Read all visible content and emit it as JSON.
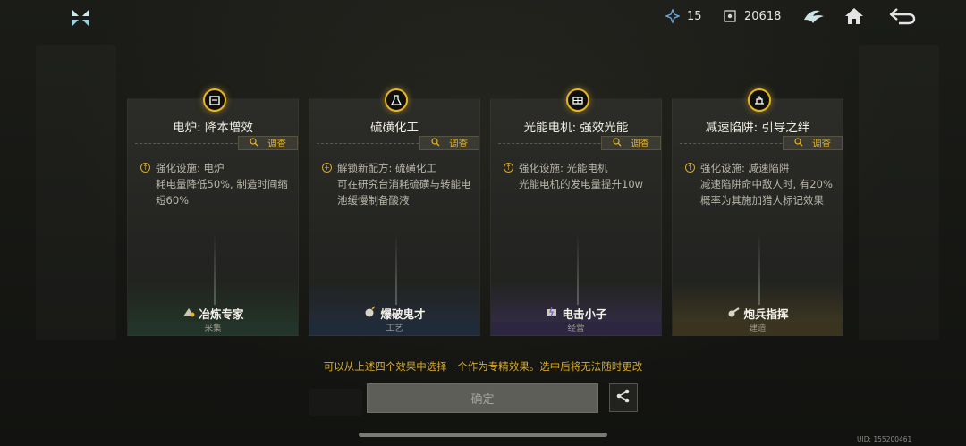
{
  "topbar": {
    "resource_a": "15",
    "resource_b": "20618",
    "icons": [
      "app-logo-icon",
      "crystal-icon",
      "target-icon",
      "emblem-icon",
      "home-icon",
      "back-arrow-icon"
    ]
  },
  "colors": {
    "accent_gold": "#e4b526",
    "hint_text": "#d7ab2e",
    "footer_green": "#23352a",
    "footer_blue": "#202b3a",
    "footer_purple": "#2c2640",
    "footer_gold": "#3a3320"
  },
  "cards": [
    {
      "title": "电炉: 降本增效",
      "inspect": "调查",
      "desc_first": "强化设施: 电炉",
      "desc_rest": "耗电量降低50%, 制造时间缩短60%",
      "skill": "冶炼专家",
      "category": "采集"
    },
    {
      "title": "硫磺化工",
      "inspect": "调查",
      "desc_first": "解锁新配方: 硫磺化工",
      "desc_rest": "可在研究台消耗硫磺与转能电池缓慢制备酸液",
      "skill": "爆破鬼才",
      "category": "工艺"
    },
    {
      "title": "光能电机: 强效光能",
      "inspect": "调查",
      "desc_first": "强化设施: 光能电机",
      "desc_rest": "光能电机的发电量提升10w",
      "skill": "电击小子",
      "category": "经营"
    },
    {
      "title": "减速陷阱: 引导之绊",
      "inspect": "调查",
      "desc_first": "强化设施: 减速陷阱",
      "desc_rest": "减速陷阱命中敌人时, 有20%概率为其施加猎人标记效果",
      "skill": "炮兵指挥",
      "category": "建造"
    }
  ],
  "hint": "可以从上述四个效果中选择一个作为专精效果。选中后将无法随时更改",
  "confirm_label": "确定",
  "uid": "UID: 155200461"
}
